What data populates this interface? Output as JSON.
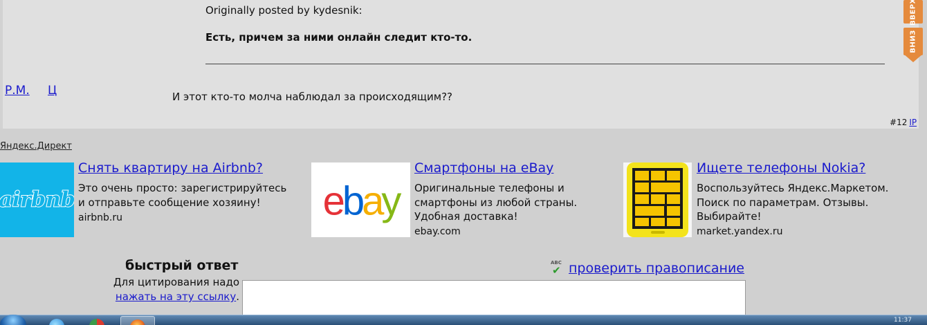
{
  "post": {
    "quote_author": "Originally posted by kydesnik:",
    "quote_text": "Есть, причем за ними онлайн следит кто-то.",
    "author_links": [
      "Р.М.",
      "Ц"
    ],
    "body": "И этот кто-то молча наблюдал за происходящим??",
    "number": "#12",
    "ip_label": "IP"
  },
  "scroll_buttons": {
    "up_label": "ВВЕРХ",
    "down_label": "ВНИЗ",
    "color": "#e58a3c"
  },
  "direct": {
    "label": "Яндекс.Директ",
    "ads": [
      {
        "title": "Снять квартиру на Airbnb?",
        "text": "Это очень просто: зарегистрируйтесь\nи отправьте сообщение хозяину!",
        "domain": "airbnb.ru",
        "logo_text": "airbnb",
        "logo_color": "#12b4e8"
      },
      {
        "title": "Смартфоны на eBay",
        "text": "Оригинальные телефоны и\nсмартфоны из любой страны.\nУдобная доставка!",
        "domain": "ebay.com",
        "logo_letters": [
          "e",
          "b",
          "a",
          "y"
        ],
        "logo_colors": [
          "#e53238",
          "#0064d2",
          "#f5af02",
          "#86b817"
        ]
      },
      {
        "title": "Ищете телефоны Nokia?",
        "text": "Воспользуйтесь Яндекс.Маркетом.\nПоиск по параметрам. Отзывы.\nВыбирайте!",
        "domain": "market.yandex.ru",
        "phone_color": "#f3e31c"
      }
    ]
  },
  "quick_reply": {
    "title": "быстрый ответ",
    "hint": "Для цитирования надо",
    "hint_link": "нажать на эту ссылку",
    "hint_suffix": ".",
    "spell_check": "проверить правописание",
    "spell_icon_text": "ABC"
  },
  "taskbar": {
    "apps": [
      "internet-explorer",
      "chrome",
      "firefox"
    ],
    "active_app": "firefox",
    "clock": "11:37"
  }
}
